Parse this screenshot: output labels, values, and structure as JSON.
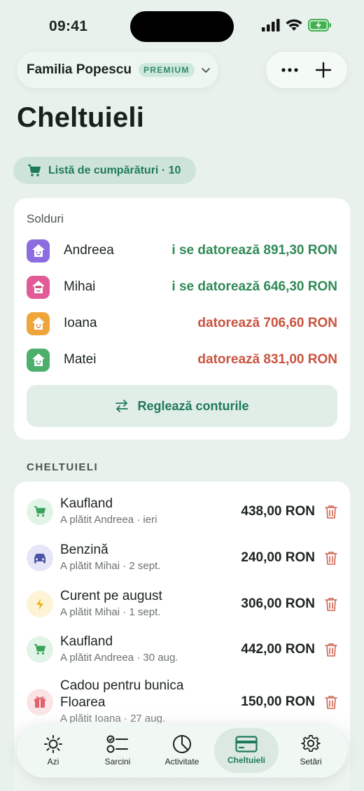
{
  "status": {
    "time": "09:41"
  },
  "header": {
    "family_name": "Familia Popescu",
    "badge": "PREMIUM"
  },
  "page": {
    "title": "Cheltuieli"
  },
  "shopping": {
    "label": "Listă de cumpărături · 10"
  },
  "balances": {
    "label": "Solduri",
    "people": [
      {
        "name": "Andreea",
        "amount": "i se datorează 891,30 RON",
        "status": "positive",
        "color": "#8c6de0"
      },
      {
        "name": "Mihai",
        "amount": "i se datorează 646,30 RON",
        "status": "positive",
        "color": "#e25b96"
      },
      {
        "name": "Ioana",
        "amount": "datorează 706,60 RON",
        "status": "negative",
        "color": "#f0a53a"
      },
      {
        "name": "Matei",
        "amount": "datorează 831,00 RON",
        "status": "negative",
        "color": "#4caf6b"
      }
    ],
    "settle_label": "Reglează conturile"
  },
  "expenses": {
    "section_label": "CHELTUIELI",
    "items": [
      {
        "title": "Kaufland",
        "subtitle": "A plătit Andreea · ieri",
        "amount": "438,00 RON",
        "icon": "cart-icon"
      },
      {
        "title": "Benzină",
        "subtitle": "A plătit Mihai · 2 sept.",
        "amount": "240,00 RON",
        "icon": "car-icon"
      },
      {
        "title": "Curent pe august",
        "subtitle": "A plătit Mihai · 1 sept.",
        "amount": "306,00 RON",
        "icon": "lightning-icon"
      },
      {
        "title": "Kaufland",
        "subtitle": "A plătit Andreea · 30 aug.",
        "amount": "442,00 RON",
        "icon": "cart-icon"
      },
      {
        "title": "Cadou pentru bunica Floarea",
        "subtitle": "A plătit Ioana · 27 aug.",
        "amount": "150,00 RON",
        "icon": "gift-icon"
      }
    ]
  },
  "tabs": [
    {
      "label": "Azi",
      "icon": "sun-icon"
    },
    {
      "label": "Sarcini",
      "icon": "checklist-icon"
    },
    {
      "label": "Activitate",
      "icon": "pie-chart-icon"
    },
    {
      "label": "Cheltuieli",
      "icon": "card-icon",
      "active": true
    },
    {
      "label": "Setări",
      "icon": "gear-icon"
    }
  ],
  "colors": {
    "accent": "#1f7a5c",
    "positive": "#2f8a56",
    "negative": "#c8533f",
    "background": "#e9f1ec"
  }
}
